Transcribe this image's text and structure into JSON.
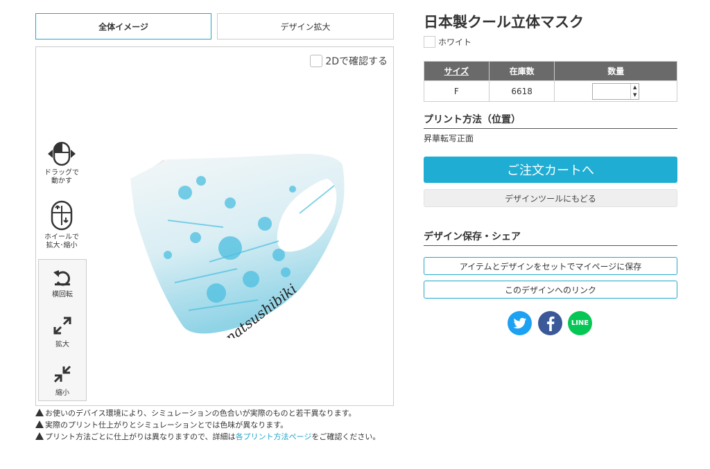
{
  "tabs": {
    "overview": "全体イメージ",
    "zoom": "デザイン拡大"
  },
  "viewer": {
    "check_2d": "2Dで確認する",
    "drag_label_1": "ドラッグで",
    "drag_label_2": "動かす",
    "wheel_label_1": "ホイールで",
    "wheel_label_2": "拡大･縮小",
    "rotate_label": "横回転",
    "zoom_in_label": "拡大",
    "zoom_out_label": "縮小",
    "mask_signature": "natsushibiki"
  },
  "notes": {
    "note1": "お使いのデバイス環境により、シミュレーションの色合いが実際のものと若干異なります。",
    "note2": "実際のプリント仕上がりとシミュレーションとでは色味が異なります。",
    "note3_before": "プリント方法ごとに仕上がりは異なりますので、詳細は",
    "note3_link": "各プリント方法ページ",
    "note3_after": "をご確認ください。"
  },
  "product": {
    "title": "日本製クール立体マスク",
    "color_name": "ホワイト",
    "table_headers": {
      "size": "サイズ",
      "stock": "在庫数",
      "qty": "数量"
    },
    "row": {
      "size": "F",
      "stock": "6618"
    },
    "print_method_heading": "プリント方法（位置）",
    "print_method_value": "昇華転写正面",
    "cart_button": "ご注文カートへ",
    "back_button": "デザインツールにもどる",
    "save_heading": "デザイン保存・シェア",
    "save_button": "アイテムとデザインをセットでマイページに保存",
    "link_button": "このデザインへのリンク"
  },
  "social": {
    "line_label": "LINE"
  },
  "colors": {
    "accent": "#1fadd3",
    "twitter": "#1da1f2",
    "facebook": "#3b5998",
    "line": "#06c755",
    "table_header": "#6a6a6a"
  }
}
